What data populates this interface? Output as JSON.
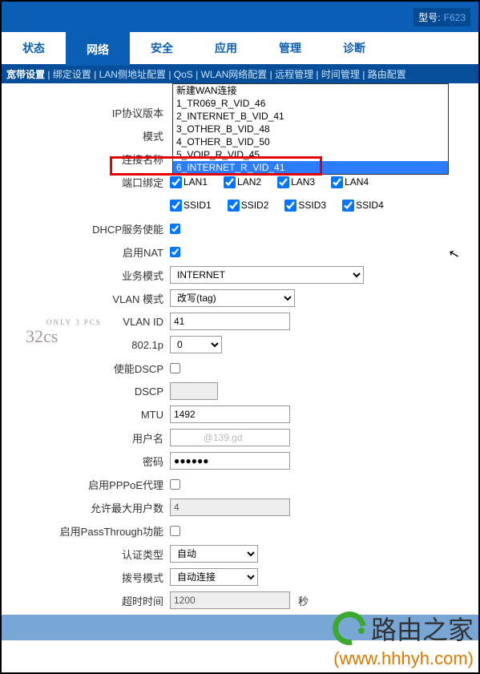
{
  "header": {
    "model_label": "型号:",
    "model_value": "F623"
  },
  "tabs": {
    "status": "状态",
    "network": "网络",
    "security": "安全",
    "app": "应用",
    "manage": "管理",
    "diag": "诊断"
  },
  "subnav": {
    "items": [
      "宽带设置",
      "绑定设置",
      "LAN侧地址配置",
      "QoS",
      "WLAN网络配置",
      "远程管理",
      "时间管理",
      "路由配置"
    ],
    "sep": " | "
  },
  "dropdown": {
    "new": "新建WAN连接",
    "o1": "1_TR069_R_VID_46",
    "o2": "2_INTERNET_B_VID_41",
    "o3": "3_OTHER_B_VID_48",
    "o4": "4_OTHER_B_VID_50",
    "o5": "5_VOIP_R_VID_45",
    "o6": "6_INTERNET_R_VID_41"
  },
  "form": {
    "ip_ver": "IP协议版本",
    "mode": "模式",
    "conn_name": "连接名称",
    "port_bind": "端口绑定",
    "lans": {
      "l1": "LAN1",
      "l2": "LAN2",
      "l3": "LAN3",
      "l4": "LAN4"
    },
    "ssids": {
      "s1": "SSID1",
      "s2": "SSID2",
      "s3": "SSID3",
      "s4": "SSID4"
    },
    "dhcp": "DHCP服务使能",
    "nat": "启用NAT",
    "svc_mode": "业务模式",
    "svc_mode_val": "INTERNET",
    "vlan_mode": "VLAN 模式",
    "vlan_mode_val": "改写(tag)",
    "vlan_id": "VLAN ID",
    "vlan_id_val": "41",
    "p8021": "802.1p",
    "p8021_val": "0",
    "dscp_en": "使能DSCP",
    "dscp": "DSCP",
    "mtu": "MTU",
    "mtu_val": "1492",
    "user": "用户名",
    "user_val": "           @139.gd",
    "pass": "密码",
    "pass_val": "●●●●●●",
    "pppoe_proxy": "启用PPPoE代理",
    "max_users": "允许最大用户数",
    "max_users_val": "4",
    "passthrough": "启用PassThrough功能",
    "auth_type": "认证类型",
    "auth_type_val": "自动",
    "dial_mode": "拨号模式",
    "dial_mode_val": "自动连接",
    "timeout": "超时时间",
    "timeout_val": "1200",
    "sec": "秒"
  },
  "watermark": {
    "top": "ONLY 3 PCS",
    "main": "32cs"
  },
  "footer": {
    "brand": "路由之家",
    "url": "(www.hhhyh.com)"
  }
}
